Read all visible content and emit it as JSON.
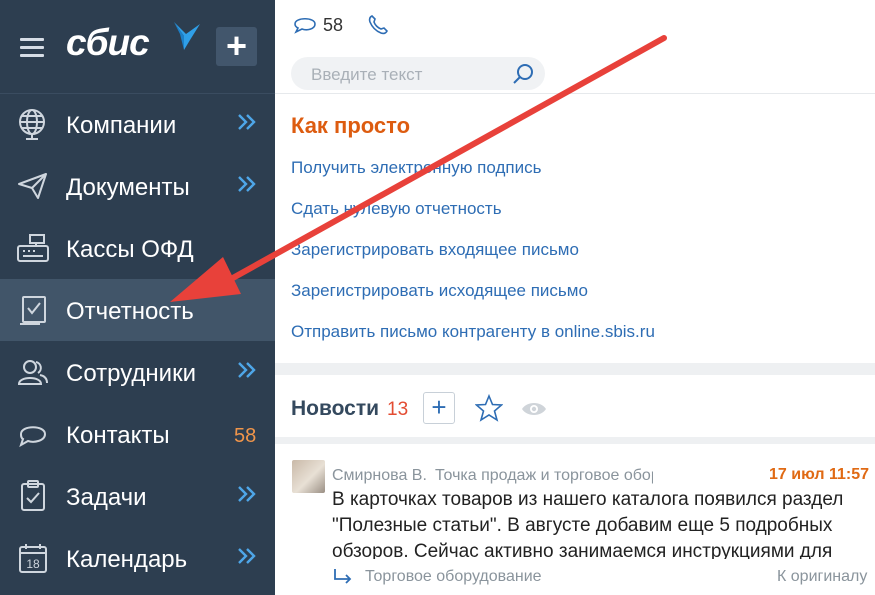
{
  "sidebar": {
    "logo_text": "сбис",
    "items": [
      {
        "label": "Компании",
        "icon": "globe-icon",
        "arrow": true,
        "badge": ""
      },
      {
        "label": "Документы",
        "icon": "paper-plane-icon",
        "arrow": true,
        "badge": ""
      },
      {
        "label": "Кассы ОФД",
        "icon": "cash-register-icon",
        "arrow": false,
        "badge": ""
      },
      {
        "label": "Отчетность",
        "icon": "report-icon",
        "arrow": false,
        "badge": ""
      },
      {
        "label": "Сотрудники",
        "icon": "people-icon",
        "arrow": true,
        "badge": ""
      },
      {
        "label": "Контакты",
        "icon": "chat-icon",
        "arrow": false,
        "badge": "58"
      },
      {
        "label": "Задачи",
        "icon": "clipboard-check-icon",
        "arrow": true,
        "badge": ""
      },
      {
        "label": "Календарь",
        "icon": "calendar-icon",
        "arrow": true,
        "badge": ""
      }
    ],
    "calendar_day": "18",
    "active_index": 3
  },
  "header": {
    "chat_count": "58",
    "search_placeholder": "Введите текст"
  },
  "how_to": {
    "title": "Как просто",
    "links": [
      "Получить электронную подпись",
      "Сдать нулевую отчетность",
      "Зарегистрировать входящее письмо",
      "Зарегистрировать исходящее письмо",
      "Отправить письмо контрагенту в online.sbis.ru"
    ]
  },
  "news": {
    "title": "Новости",
    "count": "13",
    "post": {
      "author": "Смирнова В.",
      "channel": "Точка продаж и торговое оборудование",
      "date": "17 июл 11:57",
      "text": "В карточках товаров из нашего каталога появился раздел \"Полезные статьи\". В августе добавим еще 5 подробных обзоров. Сейчас активно занимаемся инструкциями для",
      "tag": "Торговое оборудование",
      "original_link": "К оригиналу"
    }
  },
  "colors": {
    "sidebar_bg": "#2d3e50",
    "active_item_bg": "#415569",
    "accent_orange": "#dd5c10",
    "link_blue": "#2e6db4",
    "badge_orange": "#f0954a",
    "annotation_arrow": "#e8413a"
  }
}
